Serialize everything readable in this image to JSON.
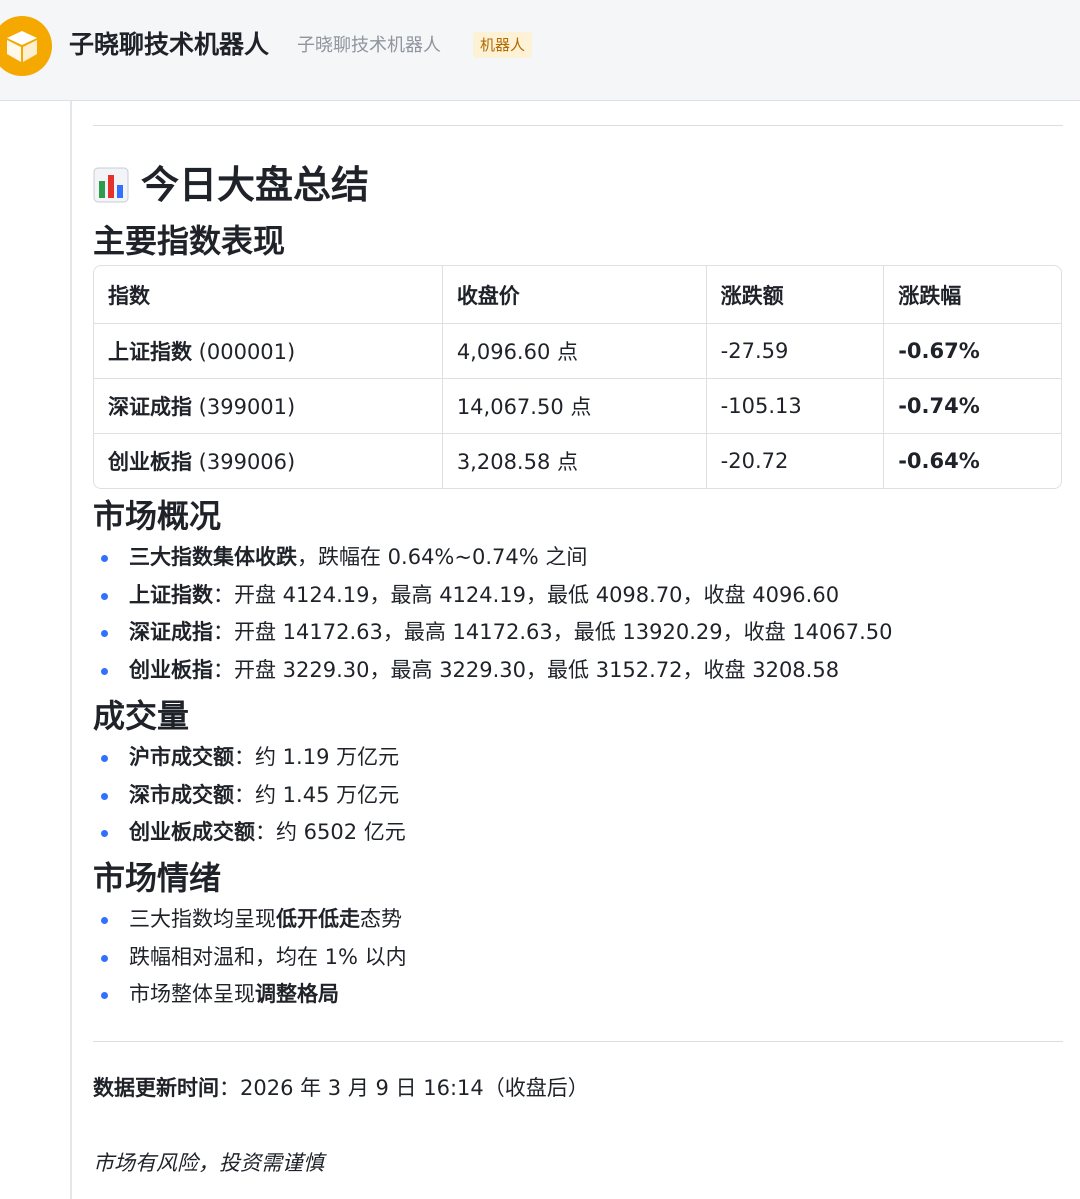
{
  "header": {
    "bot_name": "子晓聊技术机器人",
    "bot_subname": "子晓聊技术机器人",
    "badge": "机器人",
    "avatar_color": "#f5a900"
  },
  "card": {
    "title_icon": "bar-chart-icon",
    "title": "今日大盘总结",
    "indices_heading": "主要指数表现",
    "table": {
      "headers": [
        "指数",
        "收盘价",
        "涨跌额",
        "涨跌幅"
      ],
      "rows": [
        {
          "name": "上证指数",
          "code": " (000001)",
          "close": "4,096.60 点",
          "change": "-27.59",
          "pct": "-0.67%"
        },
        {
          "name": "深证成指",
          "code": " (399001)",
          "close": "14,067.50 点",
          "change": "-105.13",
          "pct": "-0.74%"
        },
        {
          "name": "创业板指",
          "code": " (399006)",
          "close": "3,208.58 点",
          "change": "-20.72",
          "pct": "-0.64%"
        }
      ]
    },
    "overview_heading": "市场概况",
    "overview": [
      {
        "bold": "三大指数集体收跌",
        "rest": "，跌幅在 0.64%~0.74% 之间"
      },
      {
        "bold": "上证指数",
        "rest": "：开盘 4124.19，最高 4124.19，最低 4098.70，收盘 4096.60"
      },
      {
        "bold": "深证成指",
        "rest": "：开盘 14172.63，最高 14172.63，最低 13920.29，收盘 14067.50"
      },
      {
        "bold": "创业板指",
        "rest": "：开盘 3229.30，最高 3229.30，最低 3152.72，收盘 3208.58"
      }
    ],
    "volume_heading": "成交量",
    "volume": [
      {
        "bold": "沪市成交额",
        "rest": "：约 1.19 万亿元"
      },
      {
        "bold": "深市成交额",
        "rest": "：约 1.45 万亿元"
      },
      {
        "bold": "创业板成交额",
        "rest": "：约 6502 亿元"
      }
    ],
    "sentiment_heading": "市场情绪",
    "sentiment": [
      {
        "pre": "三大指数均呈现",
        "bold": "低开低走",
        "post": "态势"
      },
      {
        "pre": "跌幅相对温和，均在 1% 以内",
        "bold": "",
        "post": ""
      },
      {
        "pre": "市场整体呈现",
        "bold": "调整格局",
        "post": ""
      }
    ],
    "update_label": "数据更新时间",
    "update_value": "：2026 年 3 月 9 日 16:14（收盘后）",
    "risk_note": "市场有风险，投资需谨慎"
  }
}
